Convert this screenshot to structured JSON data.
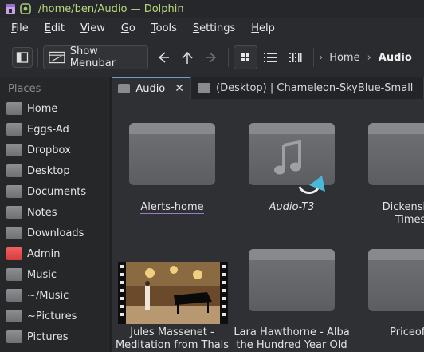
{
  "window": {
    "title": "/home/ben/Audio — Dolphin"
  },
  "menubar": {
    "items": [
      {
        "label": "File",
        "mnemonic": "F"
      },
      {
        "label": "Edit",
        "mnemonic": "E"
      },
      {
        "label": "View",
        "mnemonic": "V"
      },
      {
        "label": "Go",
        "mnemonic": "G"
      },
      {
        "label": "Tools",
        "mnemonic": "T"
      },
      {
        "label": "Settings",
        "mnemonic": "S"
      },
      {
        "label": "Help",
        "mnemonic": "H"
      }
    ]
  },
  "toolbar": {
    "show_menubar_label": "Show Menubar",
    "breadcrumb": [
      "Home",
      "Audio"
    ]
  },
  "sidebar": {
    "title": "Places",
    "items": [
      {
        "label": "Home",
        "icon": "home-folder-icon"
      },
      {
        "label": "Eggs-Ad",
        "icon": "folder-icon"
      },
      {
        "label": "Dropbox",
        "icon": "folder-icon"
      },
      {
        "label": "Desktop",
        "icon": "desktop-folder-icon"
      },
      {
        "label": "Documents",
        "icon": "documents-folder-icon"
      },
      {
        "label": "Notes",
        "icon": "folder-icon"
      },
      {
        "label": "Downloads",
        "icon": "downloads-folder-icon"
      },
      {
        "label": "Admin",
        "icon": "red-folder-icon",
        "color": "#e04848"
      },
      {
        "label": "Music",
        "icon": "music-folder-icon"
      },
      {
        "label": "~/Music",
        "icon": "music-folder-icon"
      },
      {
        "label": "~Pictures",
        "icon": "folder-icon"
      },
      {
        "label": "Pictures",
        "icon": "pictures-folder-icon"
      }
    ]
  },
  "tabs": [
    {
      "label": "Audio",
      "active": true
    },
    {
      "label": "(Desktop) | Chameleon-SkyBlue-Small",
      "active": false
    }
  ],
  "files": {
    "row1": [
      "Alerts-home",
      "Audio-T3",
      "Dickensian\nTimes"
    ],
    "row2": [
      "Jules Massenet -\nMeditation from Thais",
      "Lara Hawthorne - Alba\nthe Hundred Year Old",
      "PriceofF"
    ]
  },
  "colors": {
    "accent": "#6e9ed0",
    "title_text": "#b8d87c",
    "link_arrow": "#4ab8d8"
  }
}
